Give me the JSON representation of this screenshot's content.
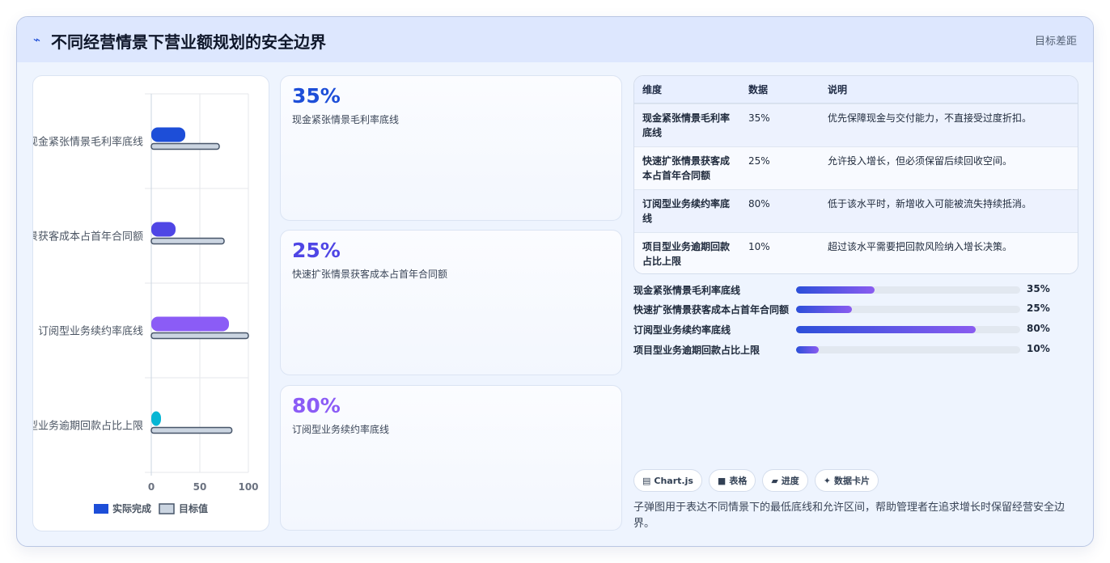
{
  "header": {
    "icon": "bolt-icon",
    "title": "不同经营情景下营业额规划的安全边界",
    "badge": "目标差距"
  },
  "chart_data": {
    "type": "bar",
    "orientation": "horizontal",
    "categories": [
      "现金紧张情景毛利率底线",
      "快速扩张情景获客成本占首年合同额",
      "订阅型业务续约率底线",
      "项目型业务逾期回款占比上限"
    ],
    "series": [
      {
        "name": "实际完成",
        "values": [
          35,
          25,
          80,
          10
        ],
        "colors": [
          "#1d4ed8",
          "#4f46e5",
          "#8b5cf6",
          "#06b6d4"
        ]
      },
      {
        "name": "目标值",
        "values": [
          70,
          75,
          100,
          83
        ],
        "color": "#cbd5e1",
        "stroke": "#475569"
      }
    ],
    "xlim": [
      0,
      100
    ],
    "xticks": [
      "0",
      "50",
      "100"
    ],
    "grid": true,
    "legend": "bottom"
  },
  "kpis": [
    {
      "value": "35%",
      "label": "现金紧张情景毛利率底线",
      "color": "#1d4ed8"
    },
    {
      "value": "25%",
      "label": "快速扩张情景获客成本占首年合同额",
      "color": "#4f46e5"
    },
    {
      "value": "80%",
      "label": "订阅型业务续约率底线",
      "color": "#8b5cf6"
    }
  ],
  "table": {
    "headers": [
      "维度",
      "数据",
      "说明"
    ],
    "rows": [
      [
        "现金紧张情景毛利率底线",
        "35%",
        "优先保障现金与交付能力，不直接受过度折扣。"
      ],
      [
        "快速扩张情景获客成本占首年合同额",
        "25%",
        "允许投入增长，但必须保留后续回收空间。"
      ],
      [
        "订阅型业务续约率底线",
        "80%",
        "低于该水平时，新增收入可能被流失持续抵消。"
      ],
      [
        "项目型业务逾期回款占比上限",
        "10%",
        "超过该水平需要把回款风险纳入增长决策。"
      ]
    ]
  },
  "progress": [
    {
      "label": "现金紧张情景毛利率底线",
      "value": "35%",
      "percent": 35
    },
    {
      "label": "快速扩张情景获客成本占首年合同额",
      "value": "25%",
      "percent": 25
    },
    {
      "label": "订阅型业务续约率底线",
      "value": "80%",
      "percent": 80
    },
    {
      "label": "项目型业务逾期回款占比上限",
      "value": "10%",
      "percent": 10
    }
  ],
  "chips": [
    {
      "icon": "chart-icon",
      "glyph": "▤",
      "label": "Chart.js"
    },
    {
      "icon": "table-icon",
      "glyph": "■",
      "label": "表格"
    },
    {
      "icon": "progress-icon",
      "glyph": "▰",
      "label": "进度"
    },
    {
      "icon": "sparkle-icon",
      "glyph": "✦",
      "label": "数据卡片"
    }
  ],
  "note": "子弹图用于表达不同情景下的最低底线和允许区间，帮助管理者在追求增长时保留经营安全边界。"
}
